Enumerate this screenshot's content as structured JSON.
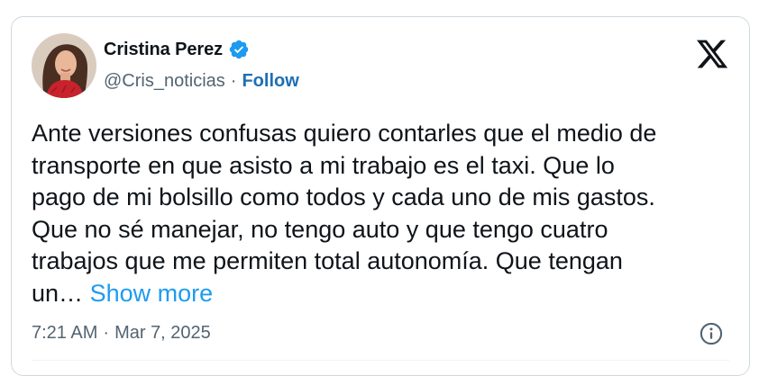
{
  "author": {
    "name": "Cristina Perez",
    "handle": "@Cris_noticias",
    "separator": "·",
    "follow_label": "Follow",
    "verified": true
  },
  "tweet": {
    "lines": [
      "Ante versiones confusas quiero contarles que el medio de",
      "transporte en que asisto a mi trabajo es el taxi. Que lo",
      "pago de mi bolsillo como todos y cada uno de mis gastos.",
      "Que no sé manejar, no tengo auto y que tengo cuatro",
      "trabajos que me permiten total autonomía. Que tengan"
    ],
    "truncated_tail": "un…",
    "show_more_label": "Show more"
  },
  "meta": {
    "time": "7:21 AM",
    "separator": "·",
    "date": "Mar 7, 2025"
  },
  "icons": {
    "verified": "verified-badge-icon",
    "logo": "x-logo-icon",
    "info": "info-icon"
  },
  "colors": {
    "verified_blue": "#1d9bf0",
    "follow_blue": "#1d6fb5",
    "link_blue": "#1d9bf0",
    "secondary_text": "#536471",
    "text": "#0f1419",
    "border": "#cfd9de"
  }
}
